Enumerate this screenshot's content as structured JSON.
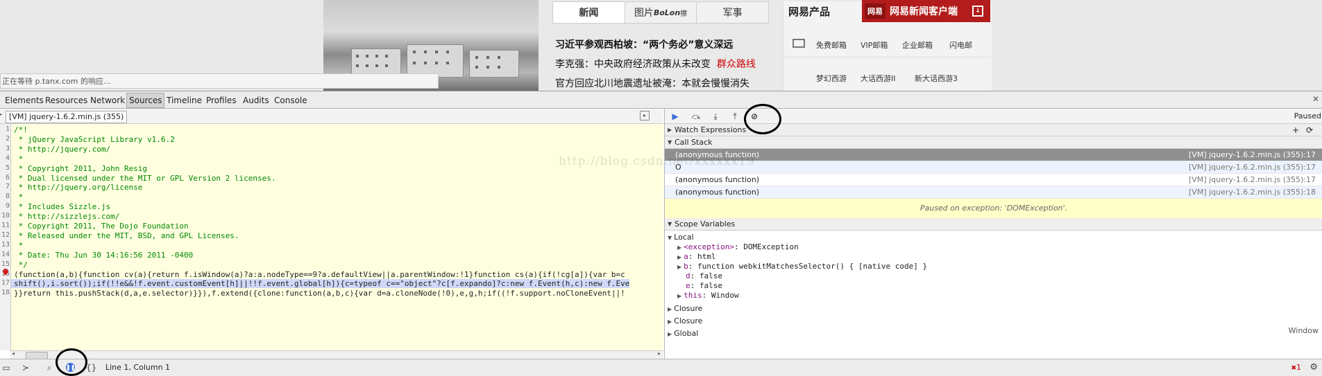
{
  "webpage": {
    "news_tabs": [
      "新闻",
      "图片",
      "军事"
    ],
    "bolang_logo": "BoLon",
    "bolang_suffix": "擦",
    "headlines": [
      {
        "text": "习近平参观西柏坡：“两个务必”意义深远",
        "red": ""
      },
      {
        "text": "李克强：中央政府经济政策从未改变",
        "red": "群众路线"
      },
      {
        "text": "官方回应北川地震遗址被淹：本就会慢慢消失",
        "red": ""
      }
    ],
    "wy_title": "网易产品",
    "wy_banner_logo": "网易",
    "wy_banner_text": "网易新闻客户端",
    "mail_links": [
      "免费邮箱",
      "VIP邮箱",
      "企业邮箱",
      "闪电邮"
    ],
    "game_links": [
      "梦幻西游",
      "大话西游II",
      "新大话西游3"
    ],
    "status_tip": "正在等待 p.tanx.com 的响应..."
  },
  "devtools": {
    "tabs": [
      "Elements",
      "Resources",
      "Network",
      "Sources",
      "Timeline",
      "Profiles",
      "Audits",
      "Console"
    ],
    "selected_tab": "Sources",
    "file_tab": "[VM] jquery-1.6.2.min.js (355)",
    "code_lines": [
      {
        "n": "1",
        "text": "/*!"
      },
      {
        "n": "2",
        "text": " * jQuery JavaScript Library v1.6.2"
      },
      {
        "n": "3",
        "text": " * http://jquery.com/"
      },
      {
        "n": "4",
        "text": " *"
      },
      {
        "n": "5",
        "text": " * Copyright 2011, John Resig"
      },
      {
        "n": "6",
        "text": " * Dual licensed under the MIT or GPL Version 2 licenses."
      },
      {
        "n": "7",
        "text": " * http://jquery.org/license"
      },
      {
        "n": "8",
        "text": " *"
      },
      {
        "n": "9",
        "text": " * Includes Sizzle.js"
      },
      {
        "n": "10",
        "text": " * http://sizzlejs.com/"
      },
      {
        "n": "11",
        "text": " * Copyright 2011, The Dojo Foundation"
      },
      {
        "n": "12",
        "text": " * Released under the MIT, BSD, and GPL Licenses."
      },
      {
        "n": "13",
        "text": " *"
      },
      {
        "n": "14",
        "text": " * Date: Thu Jun 30 14:16:56 2011 -0400"
      },
      {
        "n": "15",
        "text": " */"
      },
      {
        "n": "16",
        "text": "(function(a,b){function cv(a){return f.isWindow(a)?a:a.nodeType==9?a.defaultView||a.parentWindow:!1}function cs(a){if(!cg[a]){var b=c"
      },
      {
        "n": "17",
        "text": "shift(),i.sort());if(!!e&&!f.event.customEvent[h]||!!f.event.global[h]){c=typeof c==\"object\"?c[f.expando]?c:new f.Event(h,c):new f.Eve"
      },
      {
        "n": "18",
        "text": "}}return this.pushStack(d,a,e.selector)}}),f.extend({clone:function(a,b,c){var d=a.cloneNode(!0),e,g,h;if((!f.support.noCloneEvent||!"
      }
    ],
    "status": {
      "cursor": "Line 1, Column 1",
      "errors": "1"
    },
    "debugger": {
      "paused_label": "Paused",
      "watch_label": "Watch Expressions",
      "callstack_label": "Call Stack",
      "call_stack": [
        {
          "fn": "(anonymous function)",
          "loc": "[VM] jquery-1.6.2.min.js (355):17",
          "selected": true
        },
        {
          "fn": "O",
          "loc": "[VM] jquery-1.6.2.min.js (355):17",
          "selected": false
        },
        {
          "fn": "(anonymous function)",
          "loc": "[VM] jquery-1.6.2.min.js (355):17",
          "selected": false
        },
        {
          "fn": "(anonymous function)",
          "loc": "[VM] jquery-1.6.2.min.js (355):18",
          "selected": false
        }
      ],
      "exception_msg": "Paused on exception: 'DOMException'.",
      "scope_label": "Scope Variables",
      "local_label": "Local",
      "scope": {
        "exception_key": "<exception>",
        "exception_val": "DOMException",
        "a_key": "a",
        "a_val": "html",
        "b_key": "b",
        "b_val": "function webkitMatchesSelector() { [native code] }",
        "d_key": "d",
        "d_val": "false",
        "e_key": "e",
        "e_val": "false",
        "this_key": "this",
        "this_val": "Window"
      },
      "closure_1": "Closure",
      "closure_2": "Closure",
      "global_label": "Global",
      "window_label": "Window"
    },
    "watermark": "http://blog.csdn.net/xxxxxx19"
  }
}
